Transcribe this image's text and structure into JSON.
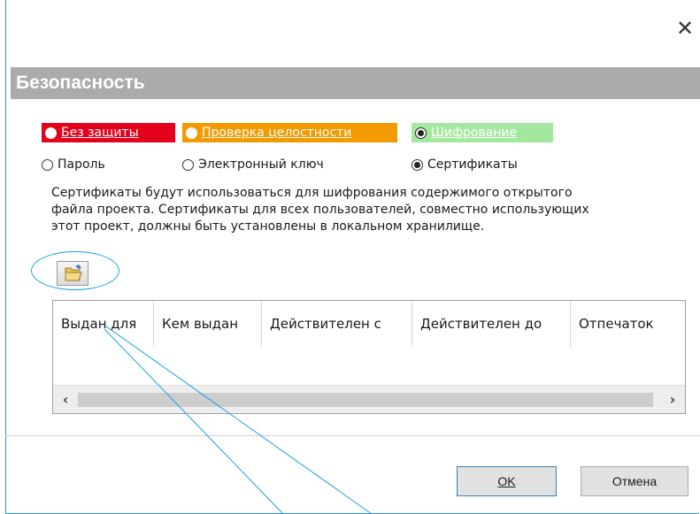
{
  "dialog": {
    "close_glyph": "✕",
    "section_title": "Безопасность"
  },
  "protection": {
    "options": [
      {
        "label": "Без защиты",
        "selected": false,
        "color": "#e3001b"
      },
      {
        "label": "Проверка целостности",
        "selected": false,
        "color": "#f39a00"
      },
      {
        "label": "Шифрование",
        "selected": true,
        "color": "#a4e8a0"
      }
    ]
  },
  "method": {
    "options": [
      {
        "label": "Пароль",
        "selected": false
      },
      {
        "label": "Электронный ключ",
        "selected": false
      },
      {
        "label": "Сертификаты",
        "selected": true
      }
    ]
  },
  "description": {
    "line1": "Сертификаты будут использоваться для шифрования содержимого открытого",
    "line2": "файла проекта. Сертификаты для всех пользователей, совместно использующих",
    "line3": "этот проект, должны быть установлены в локальном хранилище."
  },
  "toolbar": {
    "open_folder_icon": "folder-open-icon"
  },
  "table": {
    "columns": [
      "Выдан для",
      "Кем выдан",
      "Действителен с",
      "Действителен до",
      "Отпечаток"
    ],
    "rows": []
  },
  "scrollbar": {
    "left_arrow": "‹",
    "right_arrow": "›"
  },
  "buttons": {
    "ok": "OK",
    "cancel": "Отмена"
  },
  "colors": {
    "accent": "#2b8fd6",
    "callout": "#1aa0e0",
    "header_bg": "#ababab"
  }
}
